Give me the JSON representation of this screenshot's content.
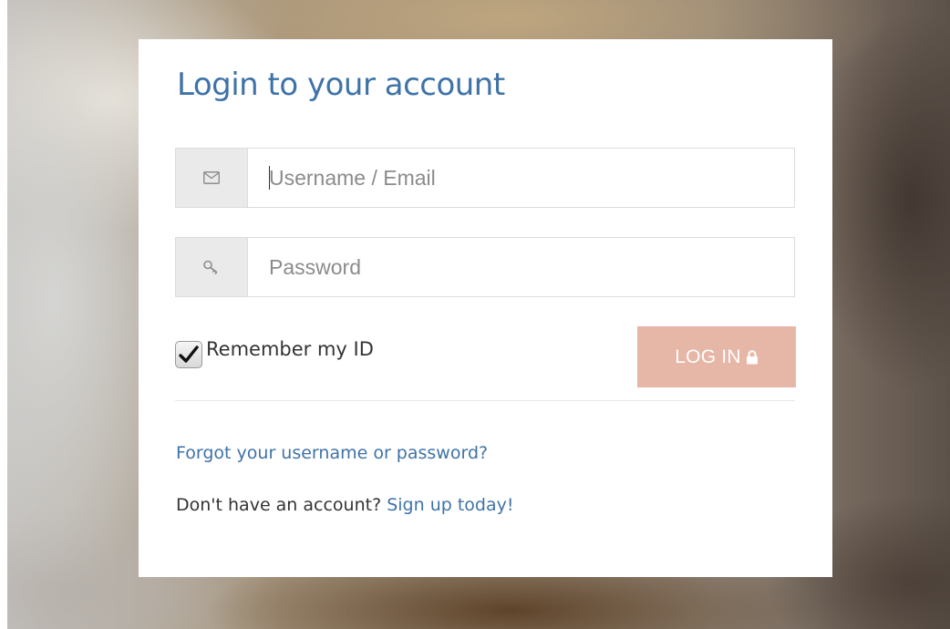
{
  "login": {
    "title": "Login to your account",
    "username": {
      "icon": "envelope-icon",
      "placeholder": "Username / Email",
      "value": ""
    },
    "password": {
      "icon": "key-icon",
      "placeholder": "Password",
      "value": ""
    },
    "remember": {
      "label": "Remember my ID",
      "checked": true
    },
    "submit": {
      "label": "LOG IN",
      "icon": "lock-icon"
    },
    "forgot_link": "Forgot your username or password?",
    "signup_prompt": "Don't have an account?",
    "signup_link": "Sign up today!"
  },
  "colors": {
    "accent": "#3f73a8",
    "button": "#e6b6a6",
    "addon": "#eaeaea"
  }
}
